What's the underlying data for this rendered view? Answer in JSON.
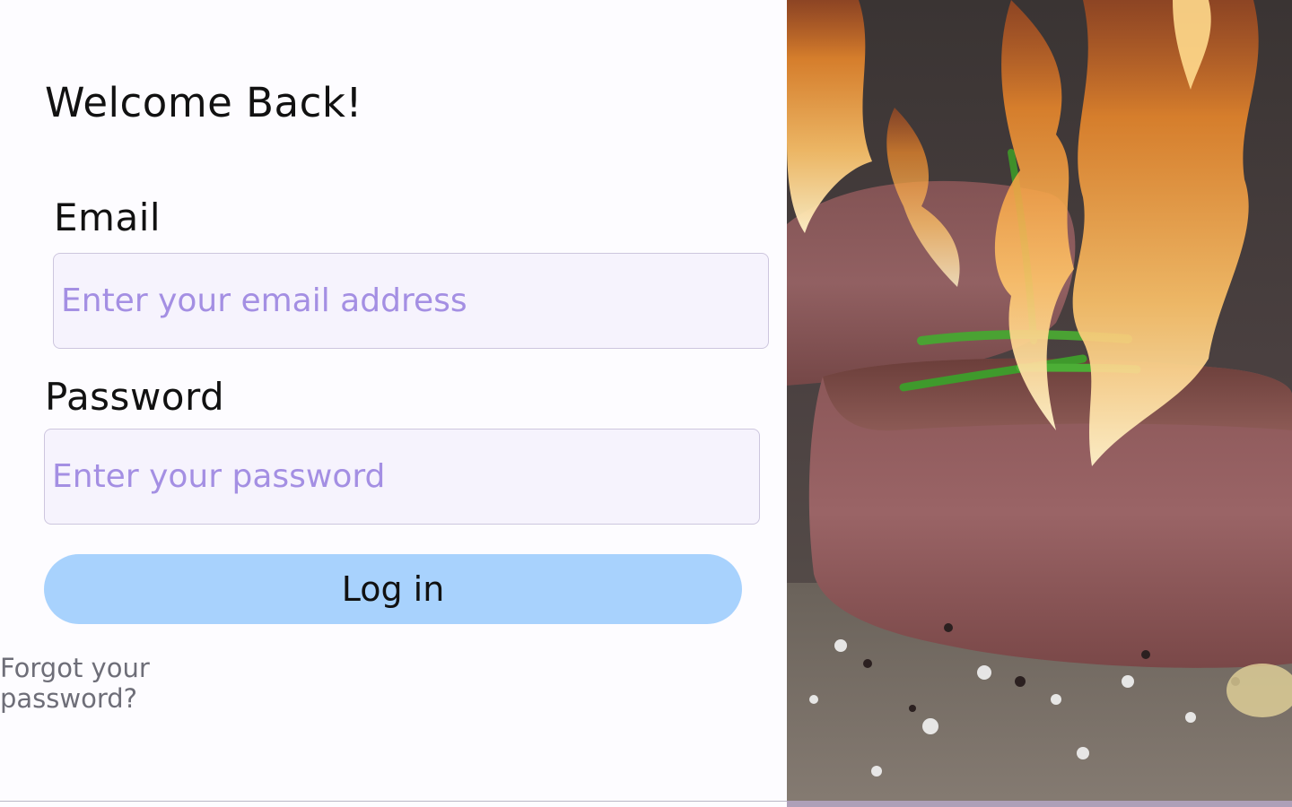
{
  "login": {
    "heading": "Welcome Back!",
    "email_label": "Email",
    "email_placeholder": "Enter your email address",
    "email_value": "",
    "password_label": "Password",
    "password_placeholder": "Enter your password",
    "password_value": "",
    "submit_label": "Log in",
    "forgot_label": "Forgot your password?"
  },
  "colors": {
    "button_bg": "#a8d2fd",
    "input_bg": "#f6f3fd",
    "placeholder": "#a48fe3",
    "link": "#6e6e78"
  },
  "hero_image": {
    "subject": "flame-grilled steak with rosemary and salt"
  }
}
